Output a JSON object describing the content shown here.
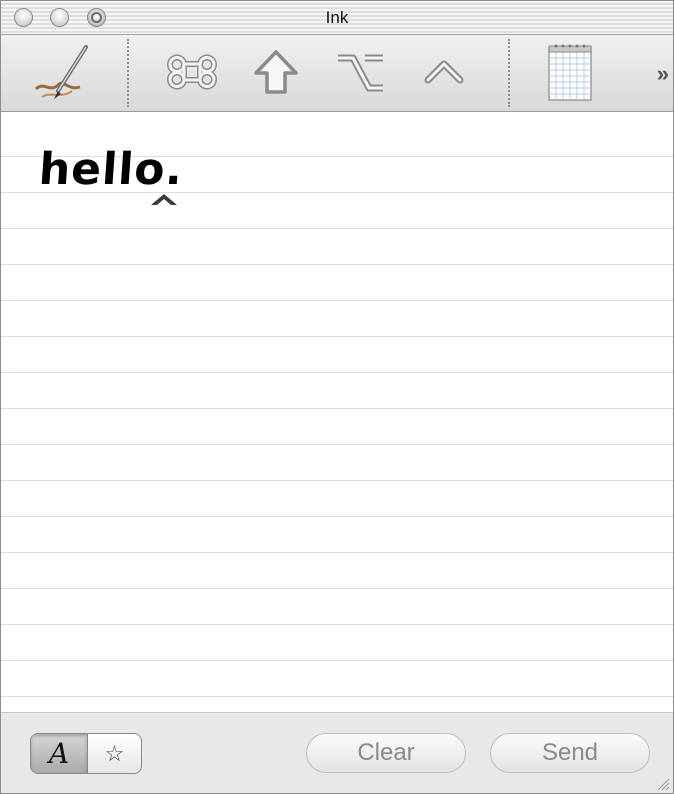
{
  "window": {
    "title": "Ink",
    "controls": [
      "close-button",
      "minimize-button",
      "zoom-button"
    ]
  },
  "toolbar": {
    "buttons": [
      {
        "name": "pen-tool",
        "icon": "pen-icon"
      },
      {
        "name": "command-key",
        "icon": "command-key-icon"
      },
      {
        "name": "shift-key",
        "icon": "shift-key-icon"
      },
      {
        "name": "option-key",
        "icon": "option-key-icon"
      },
      {
        "name": "control-key",
        "icon": "control-key-icon"
      },
      {
        "name": "notepad",
        "icon": "notepad-icon"
      },
      {
        "name": "more-items",
        "icon": "double-chevron-right-icon",
        "label": "»"
      }
    ]
  },
  "writing_area": {
    "text": "hello.",
    "caret": "^"
  },
  "bottom_bar": {
    "mode_toggle": [
      {
        "name": "letter-mode",
        "icon": "script-a-icon",
        "glyph": "A",
        "selected": true
      },
      {
        "name": "gesture-mode",
        "icon": "star-icon",
        "glyph": "☆",
        "selected": false
      }
    ],
    "clear_label": "Clear",
    "send_label": "Send"
  },
  "colors": {
    "paper": "#ffffff",
    "rule_lines": "#d6dfe8",
    "toolbar_bg": "#e4e4e4",
    "button_text": "#8a8a8a"
  }
}
